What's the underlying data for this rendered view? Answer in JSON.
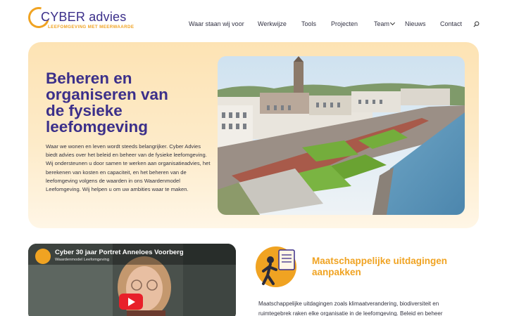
{
  "brand": {
    "name": "CYBER advies",
    "tagline": "LEEFOMGEVING MET MEERWAARDE"
  },
  "nav": {
    "items": [
      "Waar staan wij voor",
      "Werkwijze",
      "Tools",
      "Projecten",
      "Team",
      "Nieuws",
      "Contact"
    ]
  },
  "hero": {
    "title": "Beheren en organiseren van de fysieke leefomgeving",
    "text": "Waar we wonen en leven wordt steeds belangrijker. Cyber Advies biedt advies over het beleid en beheer van de fysieke leefomgeving. Wij ondersteunen u door samen te werken aan organisatieadvies, het berekenen van kosten en capaciteit, en het beheren van de leefomgeving volgens de waarden in ons Waardenmodel Leefomgeving. Wij helpen u om uw ambities waar te maken."
  },
  "video": {
    "title": "Cyber 30 jaar Portret Anneloes Voorberg",
    "subtitle": "Waardenmodel Leefomgeving"
  },
  "section": {
    "title": "Maatschappelijke uitdagingen aanpakken",
    "text": "Maatschappelijke uitdagingen zoals klimaatverandering, biodiversiteit en ruimtegebrek raken elke organisatie in de leefomgeving. Beleid en beheer"
  },
  "colors": {
    "primary": "#3b2f8a",
    "accent": "#f0a322",
    "hero_bg": "#fde3b4"
  }
}
